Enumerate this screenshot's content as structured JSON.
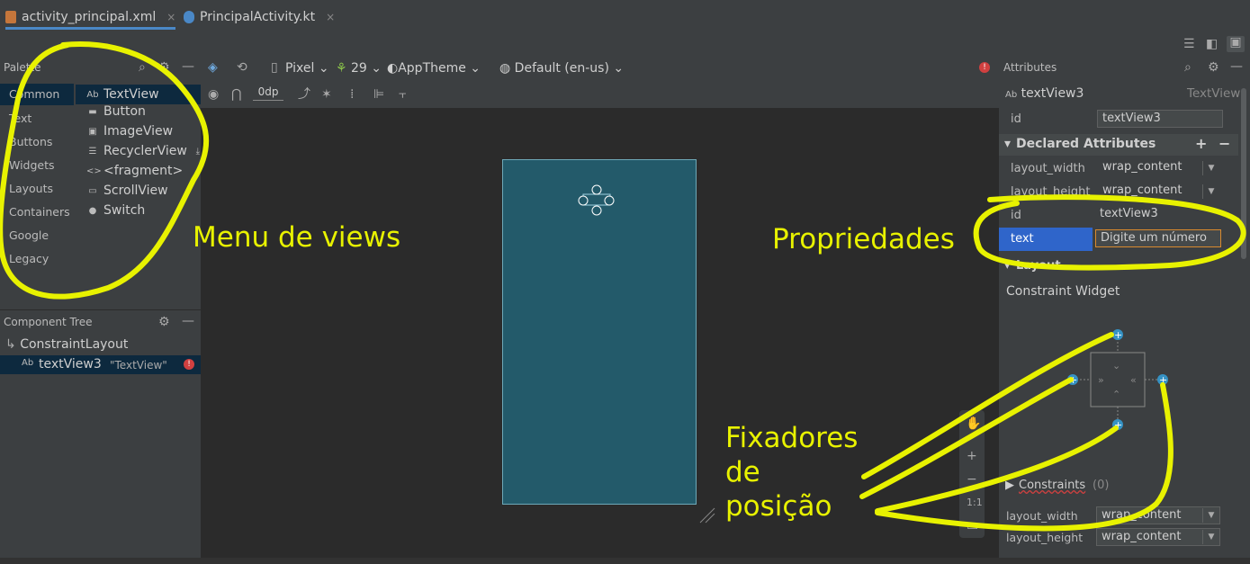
{
  "tabs": [
    {
      "label": "activity_principal.xml",
      "close": "×"
    },
    {
      "label": "PrincipalActivity.kt",
      "close": "×"
    }
  ],
  "palette": {
    "header": "Palette",
    "categories": [
      "Common",
      "Text",
      "Buttons",
      "Widgets",
      "Layouts",
      "Containers",
      "Google",
      "Legacy"
    ],
    "widgets": [
      {
        "icon": "Ab",
        "label": "TextView"
      },
      {
        "icon": "▬",
        "label": "Button"
      },
      {
        "icon": "▣",
        "label": "ImageView"
      },
      {
        "icon": "☰",
        "label": "RecyclerView"
      },
      {
        "icon": "<>",
        "label": "<fragment>"
      },
      {
        "icon": "▭",
        "label": "ScrollView"
      },
      {
        "icon": "●",
        "label": "Switch"
      }
    ]
  },
  "component_tree": {
    "header": "Component Tree",
    "root": "ConstraintLayout",
    "child_icon": "Ab",
    "child_name": "textView3",
    "child_text": "\"TextView\""
  },
  "design_toolbar": {
    "device": "Pixel",
    "api": "29",
    "theme": "AppTheme",
    "locale": "Default (en-us)",
    "margin": "0dp"
  },
  "attributes": {
    "header": "Attributes",
    "component_icon": "Ab",
    "component_name": "textView3",
    "component_type": "TextView",
    "id_label": "id",
    "id_value": "textView3",
    "declared_header": "Declared Attributes",
    "declared": [
      {
        "key": "layout_width",
        "value": "wrap_content"
      },
      {
        "key": "layout_height",
        "value": "wrap_content"
      },
      {
        "key": "id",
        "value": "textView3"
      },
      {
        "key": "text",
        "value": "Digite um número"
      }
    ],
    "layout_header": "Layout",
    "constraint_widget": "Constraint Widget",
    "constraints_label": "Constraints",
    "constraints_count": "(0)",
    "layout_rows": [
      {
        "key": "layout_width",
        "value": "wrap_content"
      },
      {
        "key": "layout_height",
        "value": "wrap_content"
      }
    ]
  },
  "annotations": {
    "menu": "Menu de views",
    "props": "Propriedades",
    "fix1": "Fixadores",
    "fix2": "de",
    "fix3": "posição"
  },
  "colors": {
    "accent": "#4a88c7",
    "highlight": "#e8f200",
    "selected_row": "#2f65ca",
    "device_screen": "#235a6a"
  }
}
